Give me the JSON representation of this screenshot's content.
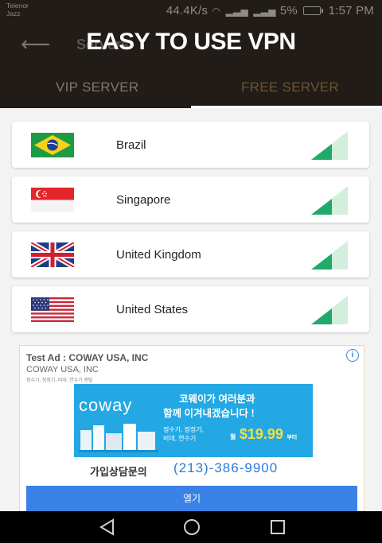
{
  "status_bar": {
    "carrier_top": "Telenor",
    "carrier_bottom": "Jazz",
    "speed": "44.4K/s",
    "sim1": "3G",
    "sim2": "4G",
    "battery": "5%",
    "time": "1:57 PM"
  },
  "header": {
    "title": "Servers",
    "overlay_text": "EASY TO USE VPN"
  },
  "tabs": [
    {
      "label": "VIP SERVER",
      "active": false
    },
    {
      "label": "FREE SERVER",
      "active": true
    }
  ],
  "servers": [
    {
      "name": "Brazil",
      "flag": "brazil-flag-icon",
      "signal": "signal-icon"
    },
    {
      "name": "Singapore",
      "flag": "singapore-flag-icon",
      "signal": "signal-icon"
    },
    {
      "name": "United Kingdom",
      "flag": "uk-flag-icon",
      "signal": "signal-icon"
    },
    {
      "name": "United States",
      "flag": "us-flag-icon",
      "signal": "signal-icon"
    }
  ],
  "ad": {
    "title": "Test Ad : COWAY USA, INC",
    "advertiser": "COWAY USA, INC",
    "small_text": "정수기, 청정기, 비데, 연수기 렌탈",
    "banner": {
      "logo": "coway",
      "line1": "코웨이가 여러분과",
      "line2": "함께 이겨내겠습니다 !",
      "products1": "정수기, 정정기,",
      "products2": "비데, 연수기",
      "price_prefix": "월",
      "price": "$19.99",
      "price_suffix": "부터"
    },
    "contact_label": "가입상담문의",
    "phone": "(213)-386-9900",
    "button_label": "열기"
  },
  "colors": {
    "header_bg": "#221c18",
    "signal_green": "#1faa6a",
    "ad_button": "#3b82e6",
    "banner_blue": "#23a8e3"
  }
}
